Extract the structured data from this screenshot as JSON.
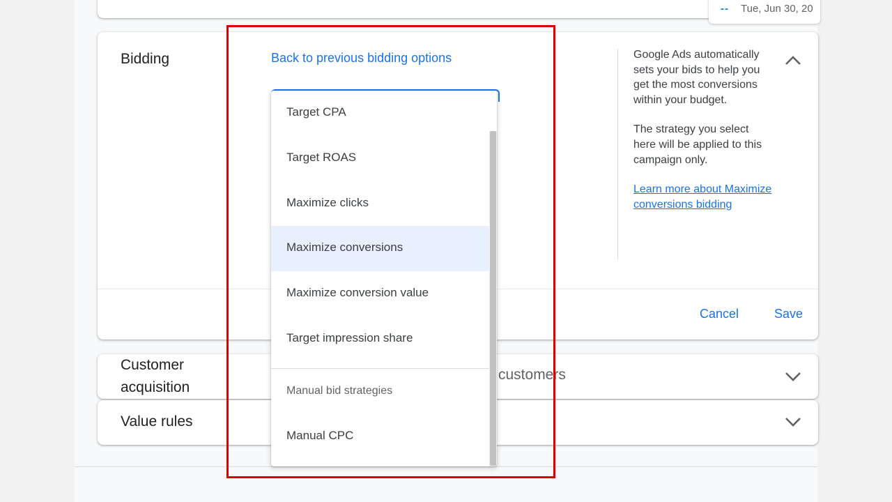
{
  "date_chip": {
    "dash": "--",
    "text": "Tue, Jun 30, 20"
  },
  "bidding": {
    "title": "Bidding",
    "back_link": "Back to previous bidding options",
    "dropdown": {
      "options": [
        "Target CPA",
        "Target ROAS",
        "Maximize clicks",
        "Maximize conversions",
        "Maximize conversion value",
        "Target impression share"
      ],
      "selected": "Maximize conversions",
      "group_label": "Manual bid strategies",
      "manual_options": [
        "Manual CPC"
      ]
    },
    "help": {
      "paragraph1": "Google Ads automatically sets your bids to help you get the most conversions within your budget.",
      "paragraph2": "The strategy you select here will be applied to this campaign only.",
      "link": "Learn more about Maximize conversions bidding"
    },
    "cancel_label": "Cancel",
    "save_label": "Save",
    "collapse_icon": "chevron-up-icon"
  },
  "customer_acquisition": {
    "title_line1": "Customer",
    "title_line2": "acquisition",
    "summary": "customers",
    "icon": "chevron-down-icon"
  },
  "value_rules": {
    "title": "Value rules",
    "icon": "chevron-down-icon"
  },
  "colors": {
    "accent": "#1a73e8",
    "selected_bg": "#e8f0fe",
    "highlight": "#e00000"
  }
}
